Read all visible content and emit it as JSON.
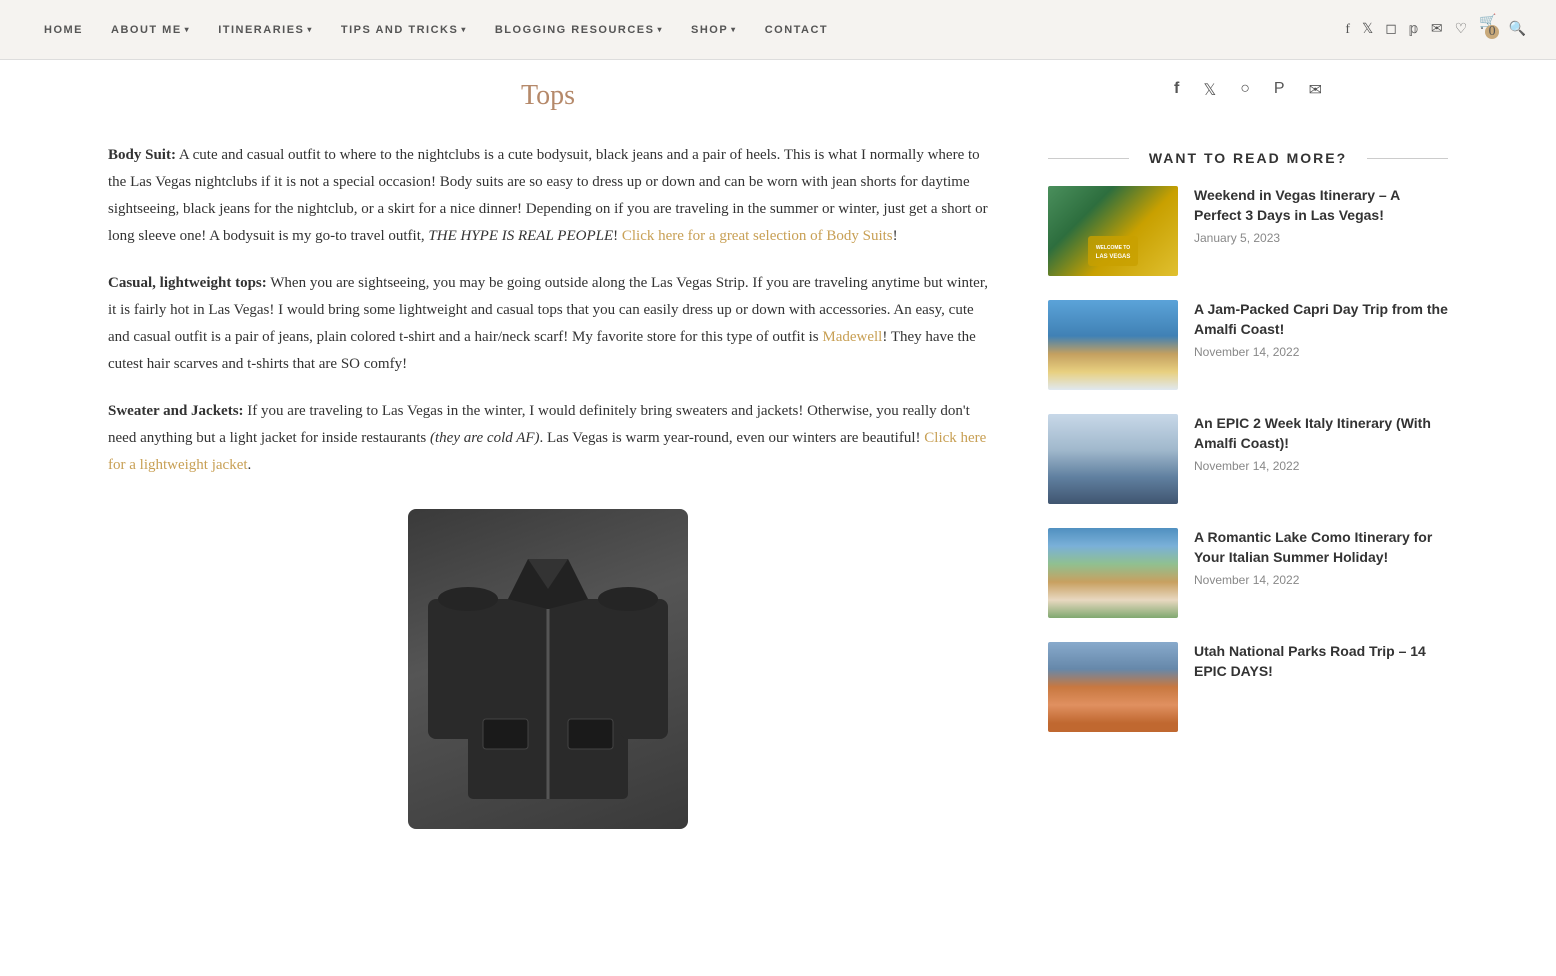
{
  "nav": {
    "links": [
      {
        "label": "HOME",
        "hasDropdown": false
      },
      {
        "label": "ABOUT ME",
        "hasDropdown": true
      },
      {
        "label": "ITINERARIES",
        "hasDropdown": true
      },
      {
        "label": "TIPS AND TRICKS",
        "hasDropdown": true
      },
      {
        "label": "BLOGGING RESOURCES",
        "hasDropdown": true
      },
      {
        "label": "SHOP",
        "hasDropdown": true
      },
      {
        "label": "CONTACT",
        "hasDropdown": false
      }
    ],
    "cartCount": "0"
  },
  "page": {
    "title": "Tops"
  },
  "content": {
    "section1": {
      "label": "Body Suit:",
      "text": " A cute and casual outfit to where to the nightclubs is a cute bodysuit, black jeans and a pair of heels. This is what I normally where to the Las Vegas nightclubs if it is not a special occasion! Body suits are so easy to dress up or down and can be worn with jean shorts for daytime sightseeing, black jeans for the nightclub, or a skirt for a nice dinner! Depending on if you are traveling in the summer or winter, just get a short or long sleeve one! A bodysuit is my go-to travel outfit, ",
      "italic": "THE HYPE IS REAL PEOPLE",
      "linkText": "Click here for a great selection of Body Suits",
      "after": "!"
    },
    "section2": {
      "label": "Casual, lightweight tops:",
      "text": " When you are sightseeing, you may be going outside along the Las Vegas Strip. If you are traveling anytime but winter, it is fairly hot in Las Vegas! I would bring some lightweight and casual tops that you can easily dress up or down with accessories. An easy, cute and casual outfit is a pair of jeans, plain colored t-shirt and a hair/neck scarf! My favorite store for this type of outfit is ",
      "linkText": "Madewell",
      "after": "! They have the cutest hair scarves and t-shirts that are SO comfy!"
    },
    "section3": {
      "label": "Sweater and Jackets:",
      "text": " If you are traveling to Las Vegas in the winter, I would definitely bring sweaters and jackets! Otherwise, you really don't need anything but a light jacket for inside restaurants ",
      "italic2": "(they are cold AF)",
      "after2": ". Las Vegas is warm year-round, even our winters are beautiful! ",
      "linkText": "Click here for a lightweight jacket",
      "end": "."
    }
  },
  "sidebar": {
    "socialIcons": [
      "facebook",
      "twitter",
      "instagram",
      "pinterest",
      "email"
    ],
    "wantMoreTitle": "WANT TO READ MORE?",
    "posts": [
      {
        "title": "Weekend in Vegas Itinerary – A Perfect 3 Days in Las Vegas!",
        "date": "January 5, 2023",
        "imgType": "vegas"
      },
      {
        "title": "A Jam-Packed Capri Day Trip from the Amalfi Coast!",
        "date": "November 14, 2022",
        "imgType": "capri"
      },
      {
        "title": "An EPIC 2 Week Italy Itinerary (With Amalfi Coast)!",
        "date": "November 14, 2022",
        "imgType": "italy"
      },
      {
        "title": "A Romantic Lake Como Itinerary for Your Italian Summer Holiday!",
        "date": "November 14, 2022",
        "imgType": "como"
      },
      {
        "title": "Utah National Parks Road Trip – 14 EPIC DAYS!",
        "date": "",
        "imgType": "utah"
      }
    ]
  }
}
